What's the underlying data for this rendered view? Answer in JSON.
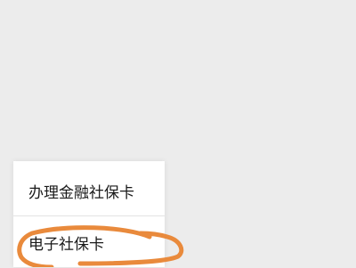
{
  "menu": {
    "items": [
      {
        "label": "办理金融社保卡"
      },
      {
        "label": "电子社保卡"
      }
    ]
  },
  "colors": {
    "background": "#ececec",
    "menu_background": "#ffffff",
    "text": "#1a1a1a",
    "annotation_stroke": "#e98a3c"
  }
}
